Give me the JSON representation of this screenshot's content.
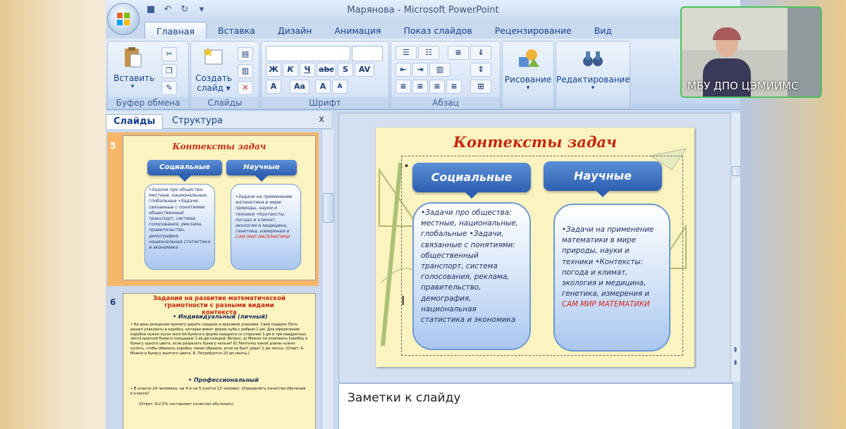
{
  "window": {
    "title": "Марянова - Microsoft PowerPoint"
  },
  "ribbon_tabs": [
    "Главная",
    "Вставка",
    "Дизайн",
    "Анимация",
    "Показ слайдов",
    "Рецензирование",
    "Вид"
  ],
  "ribbon": {
    "clipboard": {
      "paste_label": "Вставить",
      "group_label": "Буфер обмена"
    },
    "slides": {
      "new_slide_line1": "Создать",
      "new_slide_line2": "слайд ▾",
      "group_label": "Слайды"
    },
    "font": {
      "group_label": "Шрифт",
      "bold": "Ж",
      "italic": "К",
      "underline": "Ч",
      "strike": "abc",
      "shadow": "S",
      "spacing": "AV",
      "grow": "A",
      "shrink": "A",
      "case": "Aa",
      "clear": "A"
    },
    "paragraph": {
      "group_label": "Абзац"
    },
    "drawing": {
      "label": "Рисование"
    },
    "editing": {
      "label": "Редактирование"
    }
  },
  "left_panel": {
    "tabs": [
      "Слайды",
      "Структура"
    ],
    "close": "x",
    "slide5_number": "5",
    "slide6_number": "6"
  },
  "slide": {
    "title": "Контексты задач",
    "left_header": "Социальные",
    "right_header": "Научные",
    "left_text": "•Задачи про общества: местные, национальные, глобальные •Задачи, связанные с понятиями: общественный транспорт, система голосования, реклама, правительство, демография, национальная статистика и экономика",
    "right_text_main": "•Задачи на применение математики в мире природы, науки и техники •Контексты: погода и климат, экология и медицина, генетика, измерения и",
    "right_text_red": "САМ МИР МАТЕМАТИКИ",
    "bullet": "•"
  },
  "thumb6": {
    "title": "Задания на развитие математической грамотности с разными видами контекста",
    "section1": "•  Индивидуальный (личный)",
    "text1": "• На день рождения принято дарить подарок в красивой упаковке. Свой подарок Петя решил упаковать в коробку, которая имеет форму куба с ребром 1 дм. Для оформления коробки нужен кусок желтой бумаги в форме квадрата со стороной 3 дм и три квадратных листа красной бумаги площадью 1 кв.дм каждый. Вопрос: а) Можно ли упаковать коробку в бумагу одного цвета, если разрезать бумагу нельзя? б) Ленточку какой длины нужно купить, чтобы обвязать коробку таким образом, если на бант уйдет 2 дм ленты. (Ответ: А. Можно в бумагу желтого цвета. Б. Потребуется 10 дм ленты.)",
    "section2": "•  Профессиональный",
    "text2": "•  В классе 24 человека, на 4 и на 5 учатся 13 человек. Определить качество обучения в классе?",
    "answer2": "(Ответ: 8,2,5% составляет качество обучения.)"
  },
  "notes": {
    "placeholder": "Заметки к слайду"
  },
  "webcam": {
    "caption": "МБУ ДПО ЦЭМИИМС"
  }
}
